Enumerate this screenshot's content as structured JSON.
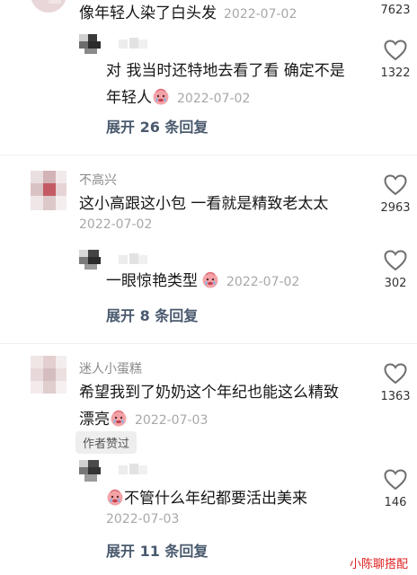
{
  "comments": [
    {
      "content": "像年轻人染了白头发",
      "date": "2022-07-02",
      "likes": "7623",
      "reply": {
        "content_line1": "对 我当时还特地去看了看 确定不是",
        "content_line2": "年轻人",
        "date": "2022-07-02",
        "likes": "1322"
      },
      "expand": "展开 26 条回复"
    },
    {
      "username": "不高兴",
      "content": "这小高跟这小包 一看就是精致老太太",
      "date": "2022-07-02",
      "likes": "2963",
      "reply": {
        "content": "一眼惊艳类型",
        "date": "2022-07-02",
        "likes": "302"
      },
      "expand": "展开 8 条回复"
    },
    {
      "username": "迷人小蛋糕",
      "content_line1": "希望我到了奶奶这个年纪也能这么精致",
      "content_line2": "漂亮",
      "date": "2022-07-03",
      "badge": "作者赞过",
      "likes": "1363",
      "reply": {
        "content": "不管什么年纪都要活出美来",
        "date": "2022-07-03",
        "likes": "146"
      },
      "expand": "展开 11 条回复"
    }
  ],
  "watermark": "小陈聊搭配",
  "colors": {
    "expand_text": "#4a5a6e",
    "date_text": "#a8a8a8",
    "watermark": "#e02020"
  }
}
